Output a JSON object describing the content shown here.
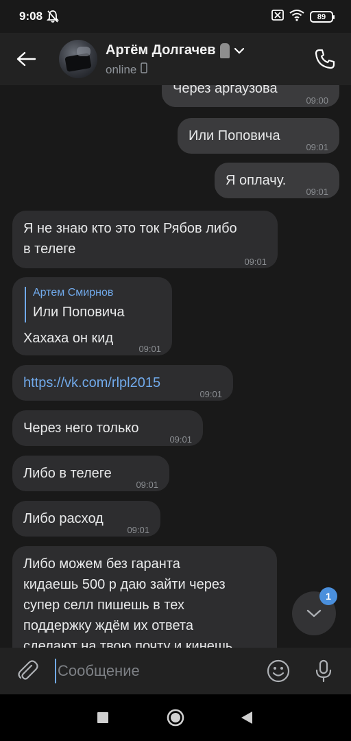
{
  "status_bar": {
    "time": "9:08",
    "battery": "89"
  },
  "header": {
    "contact_name": "Артём Долгачев",
    "status": "online"
  },
  "messages": [
    {
      "direction": "out",
      "text": "Через аргаузова",
      "time": "09:00"
    },
    {
      "direction": "out",
      "text": "Или Поповича",
      "time": "09:01"
    },
    {
      "direction": "out",
      "text": "Я оплачу.",
      "time": "09:01"
    },
    {
      "direction": "in",
      "text_line1": "Я не знаю кто это ток Рябов либо",
      "text_line2": "в телеге",
      "time": "09:01"
    },
    {
      "direction": "in",
      "reply_name": "Артем Смирнов",
      "reply_text": "Или Поповича",
      "text": "Хахаха он кид",
      "time": "09:01"
    },
    {
      "direction": "in",
      "text": "https://vk.com/rlpl2015",
      "time": "09:01"
    },
    {
      "direction": "in",
      "text": "Через него только",
      "time": "09:01"
    },
    {
      "direction": "in",
      "text": "Либо в телеге",
      "time": "09:01"
    },
    {
      "direction": "in",
      "text": "Либо расход",
      "time": "09:01"
    },
    {
      "direction": "in",
      "lines": [
        "Либо можем без гаранта",
        "кидаешь 500 р даю зайти через",
        "супер селл пишешь в тех",
        "поддержку ждём их ответа",
        "сделают на твою почту и кинешь"
      ]
    }
  ],
  "scroll_down": {
    "unread_count": "1"
  },
  "composer": {
    "placeholder": "Сообщение"
  }
}
